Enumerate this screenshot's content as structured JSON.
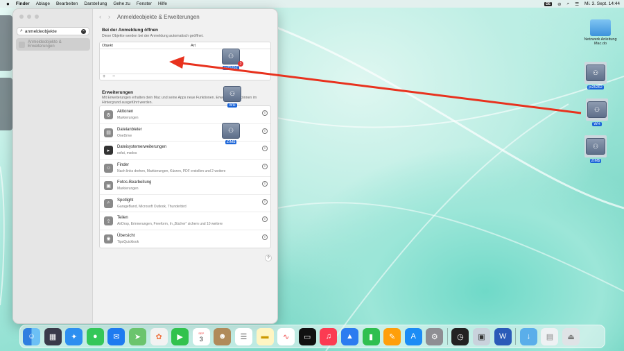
{
  "menubar": {
    "apple": "",
    "app": "Finder",
    "items": [
      "Ablage",
      "Bearbeiten",
      "Darstellung",
      "Gehe zu",
      "Fenster",
      "Hilfe"
    ],
    "input_source": "DE",
    "clock": "Mi. 3. Sept.  14:44"
  },
  "window": {
    "search_value": "anmeldeobjekte",
    "sidebar_selected": "Anmeldeobjekte & Erweiterungen",
    "title": "Anmeldeobjekte & Erweiterungen",
    "login": {
      "heading": "Bei der Anmeldung öffnen",
      "subtitle": "Diese Objekte werden bei der Anmeldung automatisch geöffnet.",
      "col_object": "Objekt",
      "col_type": "Art",
      "controls": "+ −"
    },
    "extensions": {
      "heading": "Erweiterungen",
      "subtitle": "Mit Erweiterungen erhalten dein Mac und seine Apps neue Funktionen. Erweiterungen können im Hintergrund ausgeführt werden.",
      "rows": [
        {
          "name": "Aktionen",
          "desc": "Markierungen",
          "icon": "actions-icon"
        },
        {
          "name": "Dateianbieter",
          "desc": "OneDrive",
          "icon": "file-provider-icon"
        },
        {
          "name": "Dateisystemerweiterungen",
          "desc": "exfat, msdos",
          "icon": "filesystem-icon"
        },
        {
          "name": "Finder",
          "desc": "Nach links drehen, Markierungen, Kürzen, PDF erstellen und 2 weitere",
          "icon": "finder-icon"
        },
        {
          "name": "Fotos-Bearbeitung",
          "desc": "Markierungen",
          "icon": "photos-edit-icon"
        },
        {
          "name": "Spotlight",
          "desc": "GarageBand, Microsoft Outlook, Thunderbird",
          "icon": "spotlight-icon"
        },
        {
          "name": "Teilen",
          "desc": "AirDrop, Erinnerungen, Freeform, In „Bücher“ sichern und 10 weitere",
          "icon": "share-icon"
        },
        {
          "name": "Übersicht",
          "desc": "TipsQuicklook",
          "icon": "quicklook-icon"
        }
      ]
    },
    "help": "?"
  },
  "drag": {
    "items": [
      "jo25262",
      "WH",
      "ZIM$"
    ],
    "badge": "3"
  },
  "desktop": {
    "folder_label": "Netzwerk Anleitung Mac.do",
    "drives": [
      "jo25262",
      "WH",
      "ZIM$"
    ]
  },
  "dock": {
    "calendar_month": "SEP",
    "calendar_day": "3",
    "apps": [
      "Finder",
      "Launchpad",
      "Safari",
      "Nachrichten",
      "Mail",
      "Karten",
      "Fotos",
      "FaceTime",
      "Kalender",
      "Kontakte",
      "Erinnerungen",
      "Notizen",
      "Freeform",
      "TV",
      "Musik",
      "Keynote",
      "Numbers",
      "Pages",
      "App Store",
      "Systemeinstellungen",
      "Uhr",
      "Vorschau",
      "Word",
      "Downloads",
      "Dokument",
      "Papierkorb"
    ]
  },
  "colors": {
    "arrow": "#e8321e",
    "selection": "#1a64d8",
    "accent_badge": "#e03030"
  }
}
